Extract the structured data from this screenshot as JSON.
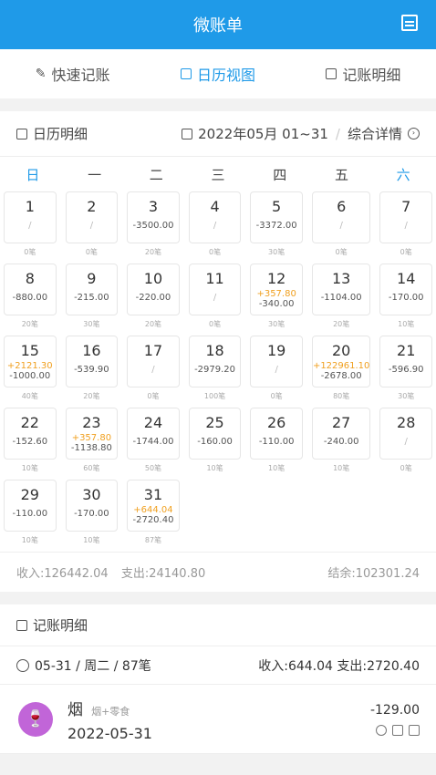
{
  "header": {
    "title": "微账单",
    "menu_icon": "list-icon"
  },
  "tabs": [
    {
      "label": "快速记账",
      "icon": "edit-icon"
    },
    {
      "label": "日历视图",
      "icon": "calendar-icon"
    },
    {
      "label": "记账明细",
      "icon": "document-icon"
    }
  ],
  "calendar": {
    "title": "日历明细",
    "range": "2022年05月 01~31",
    "details_link": "综合详情",
    "weekdays": [
      "日",
      "一",
      "二",
      "三",
      "四",
      "五",
      "六"
    ],
    "days": [
      {
        "d": "1",
        "inc": "",
        "exp": "/",
        "cnt": "0笔"
      },
      {
        "d": "2",
        "inc": "",
        "exp": "/",
        "cnt": "0笔"
      },
      {
        "d": "3",
        "inc": "",
        "exp": "-3500.00",
        "cnt": "20笔"
      },
      {
        "d": "4",
        "inc": "",
        "exp": "/",
        "cnt": "0笔"
      },
      {
        "d": "5",
        "inc": "",
        "exp": "-3372.00",
        "cnt": "30笔"
      },
      {
        "d": "6",
        "inc": "",
        "exp": "/",
        "cnt": "0笔"
      },
      {
        "d": "7",
        "inc": "",
        "exp": "/",
        "cnt": "0笔"
      },
      {
        "d": "8",
        "inc": "",
        "exp": "-880.00",
        "cnt": "20笔"
      },
      {
        "d": "9",
        "inc": "",
        "exp": "-215.00",
        "cnt": "30笔"
      },
      {
        "d": "10",
        "inc": "",
        "exp": "-220.00",
        "cnt": "20笔"
      },
      {
        "d": "11",
        "inc": "",
        "exp": "/",
        "cnt": "0笔"
      },
      {
        "d": "12",
        "inc": "+357.80",
        "exp": "-340.00",
        "cnt": "30笔"
      },
      {
        "d": "13",
        "inc": "",
        "exp": "-1104.00",
        "cnt": "20笔"
      },
      {
        "d": "14",
        "inc": "",
        "exp": "-170.00",
        "cnt": "10笔"
      },
      {
        "d": "15",
        "inc": "+2121.30",
        "exp": "-1000.00",
        "cnt": "40笔"
      },
      {
        "d": "16",
        "inc": "",
        "exp": "-539.90",
        "cnt": "20笔"
      },
      {
        "d": "17",
        "inc": "",
        "exp": "/",
        "cnt": "0笔"
      },
      {
        "d": "18",
        "inc": "",
        "exp": "-2979.20",
        "cnt": "100笔"
      },
      {
        "d": "19",
        "inc": "",
        "exp": "/",
        "cnt": "0笔"
      },
      {
        "d": "20",
        "inc": "+122961.10",
        "exp": "-2678.00",
        "cnt": "80笔"
      },
      {
        "d": "21",
        "inc": "",
        "exp": "-596.90",
        "cnt": "30笔"
      },
      {
        "d": "22",
        "inc": "",
        "exp": "-152.60",
        "cnt": "10笔"
      },
      {
        "d": "23",
        "inc": "+357.80",
        "exp": "-1138.80",
        "cnt": "60笔"
      },
      {
        "d": "24",
        "inc": "",
        "exp": "-1744.00",
        "cnt": "50笔"
      },
      {
        "d": "25",
        "inc": "",
        "exp": "-160.00",
        "cnt": "10笔"
      },
      {
        "d": "26",
        "inc": "",
        "exp": "-110.00",
        "cnt": "10笔"
      },
      {
        "d": "27",
        "inc": "",
        "exp": "-240.00",
        "cnt": "10笔"
      },
      {
        "d": "28",
        "inc": "",
        "exp": "/",
        "cnt": "0笔"
      },
      {
        "d": "29",
        "inc": "",
        "exp": "-110.00",
        "cnt": "10笔"
      },
      {
        "d": "30",
        "inc": "",
        "exp": "-170.00",
        "cnt": "10笔"
      },
      {
        "d": "31",
        "inc": "+644.04",
        "exp": "-2720.40",
        "cnt": "87笔"
      }
    ],
    "summary": {
      "income": "收入:126442.04",
      "expense": "支出:24140.80",
      "balance": "结余:102301.24"
    }
  },
  "ledger": {
    "title": "记账明细",
    "day_row": {
      "date": "05-31 / 周二 / 87笔",
      "totals": "收入:644.04 支出:2720.40"
    },
    "entry": {
      "name": "烟",
      "tag": "烟+零食",
      "date": "2022-05-31",
      "amount": "-129.00"
    }
  },
  "colors": {
    "accent": "#1f9ae8",
    "income": "#f0a020",
    "avatar": "#c165d8"
  }
}
